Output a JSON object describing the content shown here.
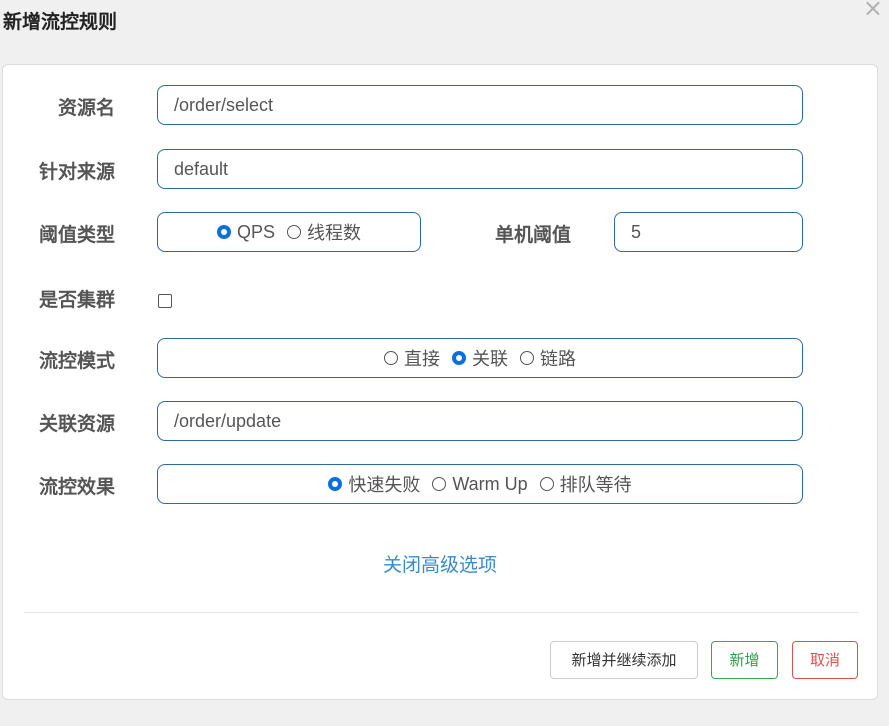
{
  "dialog": {
    "title": "新增流控规则"
  },
  "form": {
    "resource_label": "资源名",
    "resource_value": "/order/select",
    "origin_label": "针对来源",
    "origin_value": "default",
    "threshold_type_label": "阈值类型",
    "threshold_type_options": [
      "QPS",
      "线程数"
    ],
    "threshold_type_selected": "QPS",
    "single_threshold_label": "单机阈值",
    "single_threshold_value": "5",
    "cluster_label": "是否集群",
    "cluster_checked": false,
    "mode_label": "流控模式",
    "mode_options": [
      "直接",
      "关联",
      "链路"
    ],
    "mode_selected": "关联",
    "ref_resource_label": "关联资源",
    "ref_resource_value": "/order/update",
    "effect_label": "流控效果",
    "effect_options": [
      "快速失败",
      "Warm Up",
      "排队等待"
    ],
    "effect_selected": "快速失败"
  },
  "advanced_link": "关闭高级选项",
  "buttons": {
    "add_continue": "新增并继续添加",
    "add": "新增",
    "cancel": "取消"
  },
  "colors": {
    "border_accent": "#2d6aa3",
    "radio_checked": "#0b6fe0",
    "link": "#3a8ac7",
    "success": "#34a853",
    "danger": "#d9534f"
  }
}
